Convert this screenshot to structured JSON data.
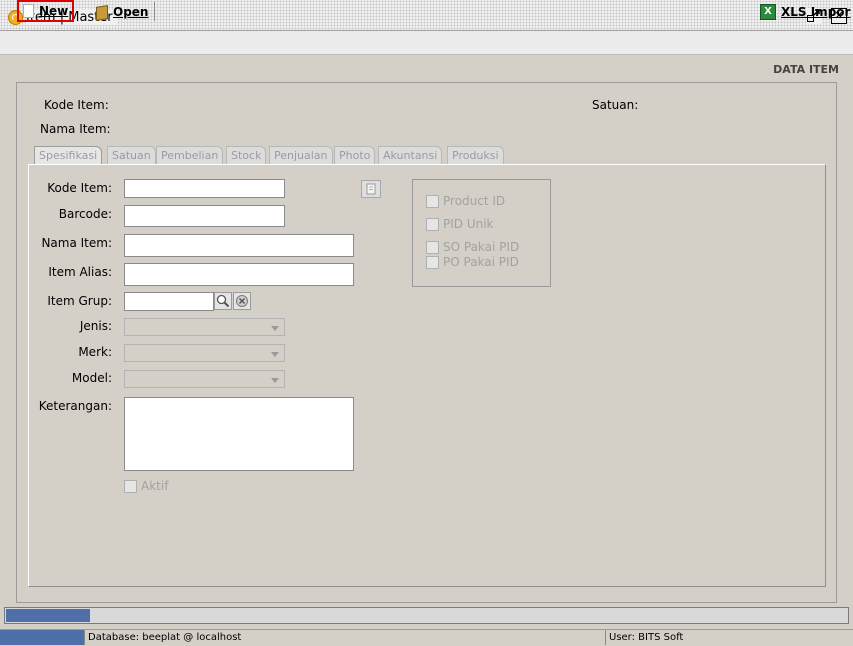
{
  "window": {
    "title": "Item | Master"
  },
  "toolbar": {
    "new_label": "New",
    "open_label": "Open",
    "xls_label": "XLS Impor"
  },
  "page": {
    "section_title": "DATA ITEM"
  },
  "header": {
    "kode_item_label": "Kode Item:",
    "nama_item_label": "Nama Item:",
    "satuan_label": "Satuan:"
  },
  "tabs": [
    {
      "label": "Spesifikasi",
      "active": true
    },
    {
      "label": "Satuan"
    },
    {
      "label": "Pembelian"
    },
    {
      "label": "Stock"
    },
    {
      "label": "Penjualan"
    },
    {
      "label": "Photo"
    },
    {
      "label": "Akuntansi"
    },
    {
      "label": "Produksi"
    }
  ],
  "form": {
    "kode_item_label": "Kode Item:",
    "barcode_label": "Barcode:",
    "nama_item_label": "Nama Item:",
    "item_alias_label": "Item Alias:",
    "item_grup_label": "Item Grup:",
    "jenis_label": "Jenis:",
    "merk_label": "Merk:",
    "model_label": "Model:",
    "keterangan_label": "Keterangan:",
    "aktif_label": "Aktif"
  },
  "pid": {
    "product_id_label": "Product ID",
    "pid_unik_label": "PID Unik",
    "so_pakai_pid_label": "SO Pakai PID",
    "po_pakai_pid_label": "PO Pakai PID"
  },
  "progress": {
    "value": 0.1
  },
  "status": {
    "database": "Database: beeplat @ localhost",
    "user": "User: BITS Soft"
  },
  "colors": {
    "highlight": "#e00000",
    "progress": "#4f6fa8"
  }
}
